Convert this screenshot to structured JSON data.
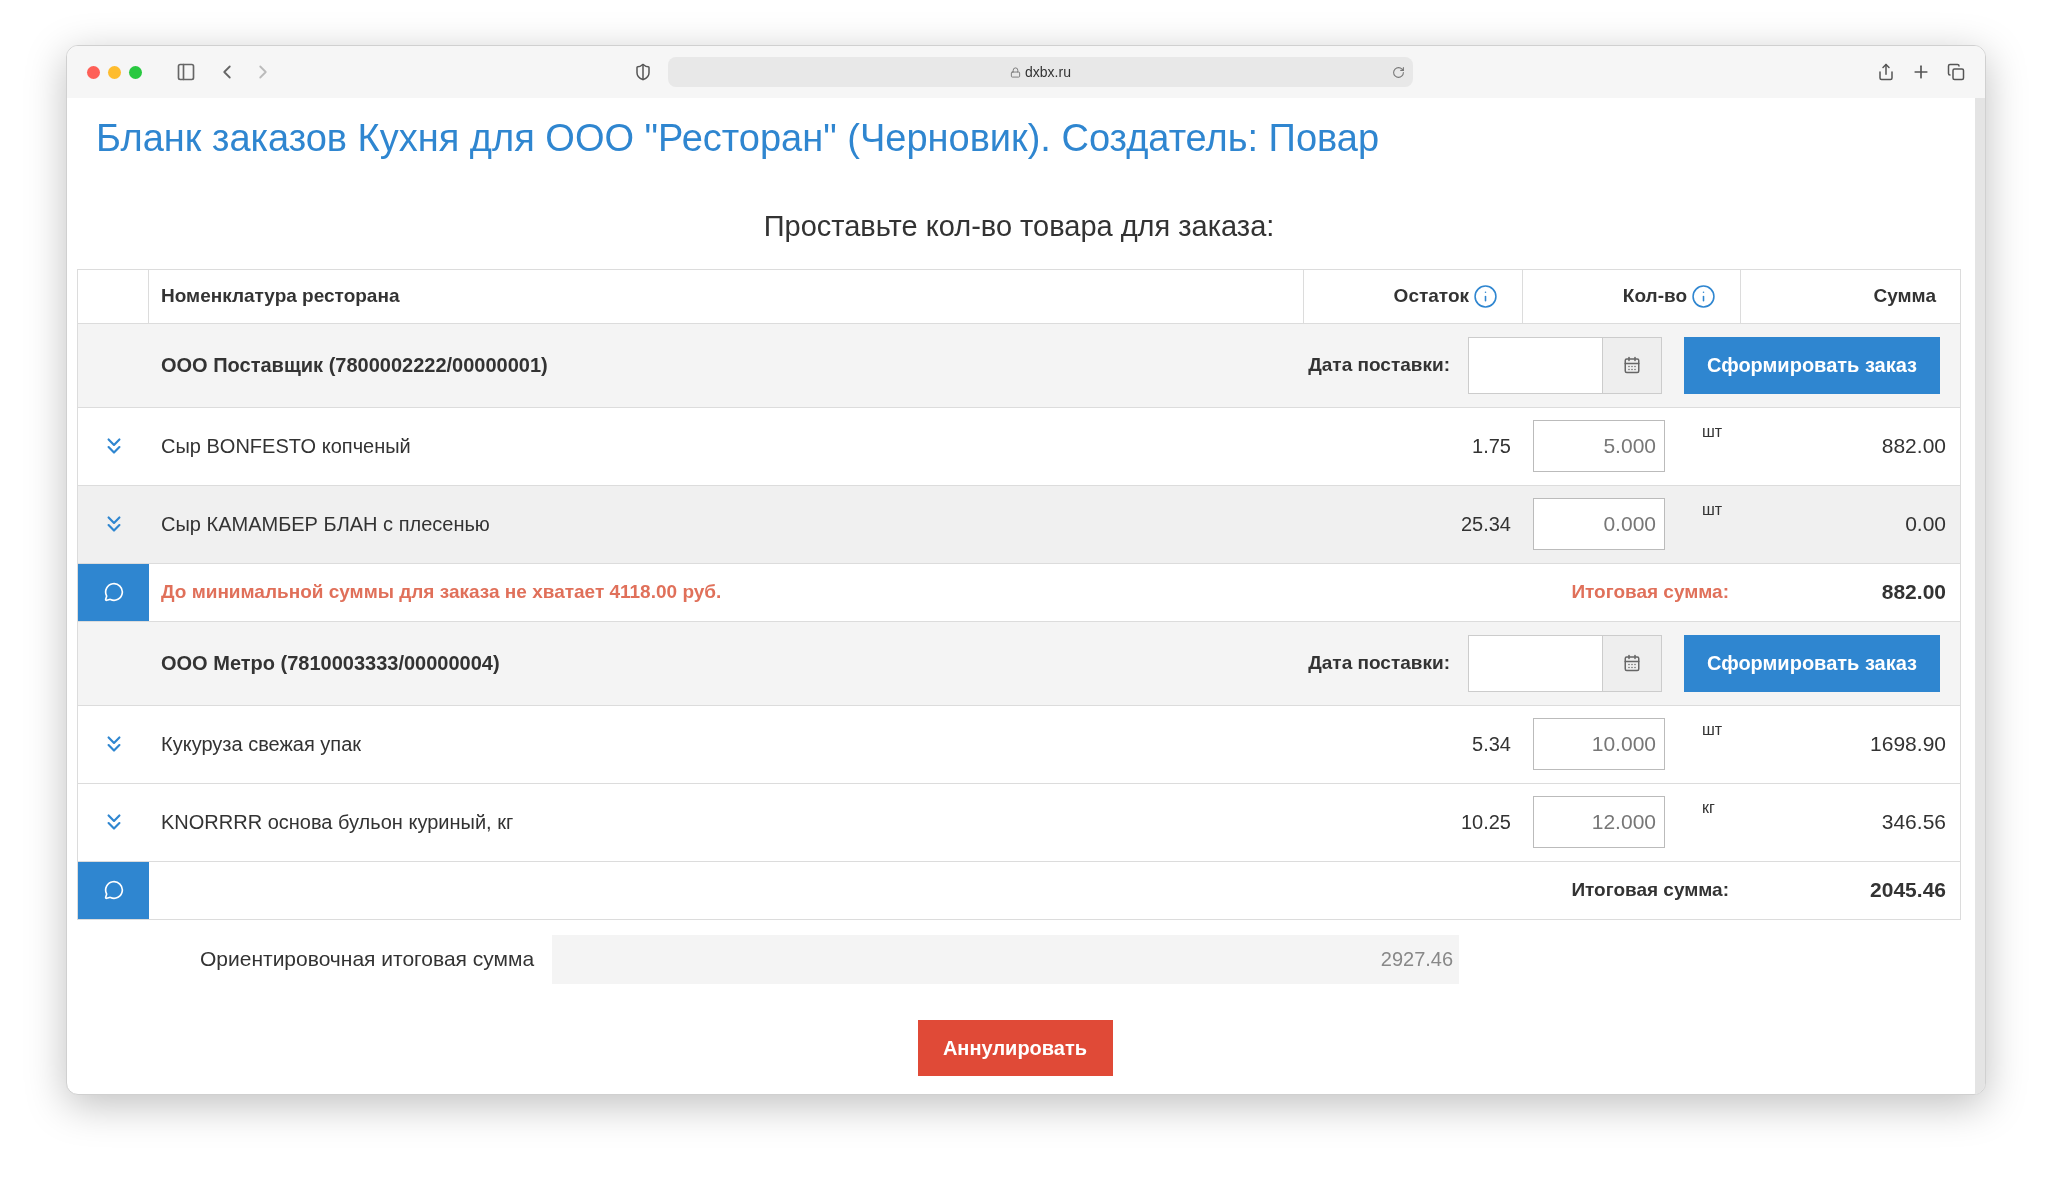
{
  "browser": {
    "url": "dxbx.ru"
  },
  "title": "Бланк заказов Кухня для ООО \"Ресторан\" (Черновик). Создатель: Повар",
  "subtitle": "Проставьте кол-во товара для заказа:",
  "table": {
    "columns": [
      {
        "label": "Номенклатура ресторана",
        "info": false
      },
      {
        "label": "Остаток",
        "info": true
      },
      {
        "label": "Кол-во",
        "info": true
      },
      {
        "label": "Сумма",
        "info": false
      }
    ]
  },
  "groups": [
    {
      "supplier": "ООО Поставщик (7800002222/00000001)",
      "date_label": "Дата поставки:",
      "order_button": "Сформировать заказ",
      "items": [
        {
          "name": "Сыр BONFESTO копченый",
          "stock": "1.75",
          "qty": "5.000",
          "unit": "шт",
          "sum": "882.00",
          "highlighted": false
        },
        {
          "name": "Сыр КАМАМБЕР БЛАН с плесенью",
          "stock": "25.34",
          "qty": "0.000",
          "unit": "шт",
          "sum": "0.00",
          "highlighted": true
        }
      ],
      "warning": "До минимальной суммы для заказа не хватает 4118.00 руб.",
      "below_minimum": true,
      "total_label": "Итоговая сумма:",
      "total": "882.00"
    },
    {
      "supplier": "ООО Метро (7810003333/00000004)",
      "date_label": "Дата поставки:",
      "order_button": "Сформировать заказ",
      "items": [
        {
          "name": "Кукуруза свежая упак",
          "stock": "5.34",
          "qty": "10.000",
          "unit": "шт",
          "sum": "1698.90",
          "highlighted": false
        },
        {
          "name": "KNORRRR основа бульон куриный, кг",
          "stock": "10.25",
          "qty": "12.000",
          "unit": "кг",
          "sum": "346.56",
          "highlighted": false
        }
      ],
      "below_minimum": false,
      "total_label": "Итоговая сумма:",
      "total": "2045.46"
    }
  ],
  "estimate": {
    "label": "Ориентировочная итоговая сумма",
    "value": "2927.46"
  },
  "cancel_button": "Аннулировать"
}
